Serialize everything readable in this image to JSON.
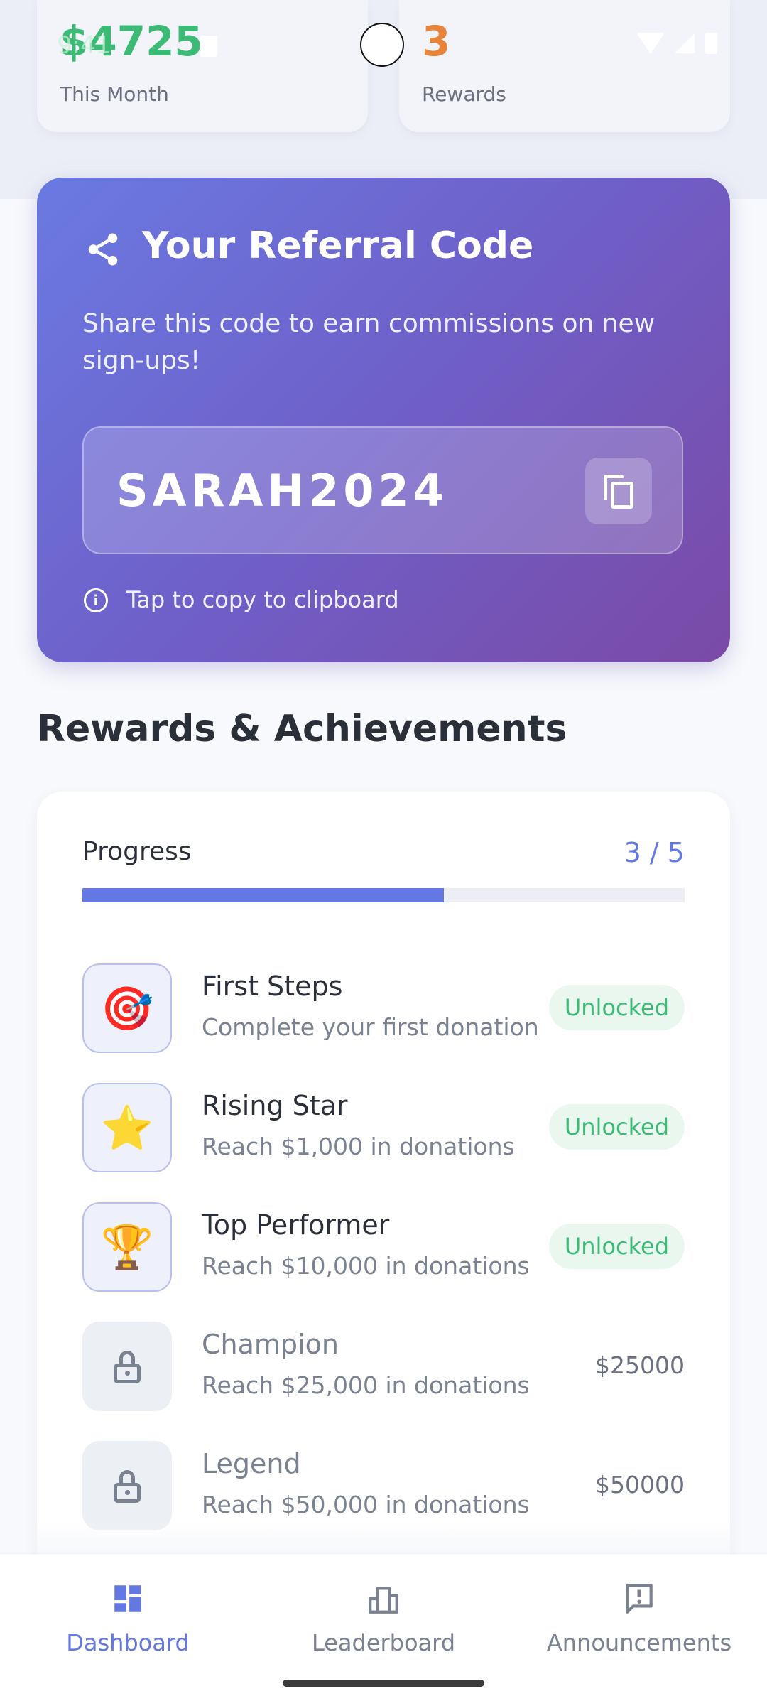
{
  "status_bar": {
    "time": "9:41"
  },
  "stats": [
    {
      "value": "$4725",
      "label": "This Month",
      "color": "#3dbb76"
    },
    {
      "value": "3",
      "label": "Rewards",
      "color": "#e8843a"
    }
  ],
  "referral": {
    "title": "Your Referral Code",
    "subtitle": "Share this code to earn commissions on new sign-ups!",
    "code": "SARAH2024",
    "hint": "Tap to copy to clipboard"
  },
  "rewards": {
    "section_title": "Rewards & Achievements",
    "progress_label": "Progress",
    "progress_count": "3 / 5",
    "progress_fraction": 0.6,
    "items": [
      {
        "title": "First Steps",
        "subtitle": "Complete your first donation",
        "icon": "target-icon",
        "status": "Unlocked"
      },
      {
        "title": "Rising Star",
        "subtitle": "Reach $1,000 in donations",
        "icon": "star-icon",
        "status": "Unlocked"
      },
      {
        "title": "Top Performer",
        "subtitle": "Reach $10,000 in donations",
        "icon": "trophy-icon",
        "status": "Unlocked"
      },
      {
        "title": "Champion",
        "subtitle": "Reach $25,000 in donations",
        "icon": "lock-icon",
        "amount": "$25000"
      },
      {
        "title": "Legend",
        "subtitle": "Reach $50,000 in donations",
        "icon": "lock-icon",
        "amount": "$50000"
      }
    ]
  },
  "nav": {
    "items": [
      {
        "label": "Dashboard",
        "icon": "dashboard-icon",
        "active": true
      },
      {
        "label": "Leaderboard",
        "icon": "leaderboard-icon",
        "active": false
      },
      {
        "label": "Announcements",
        "icon": "announcement-icon",
        "active": false
      }
    ],
    "accent": "#6478e2"
  }
}
